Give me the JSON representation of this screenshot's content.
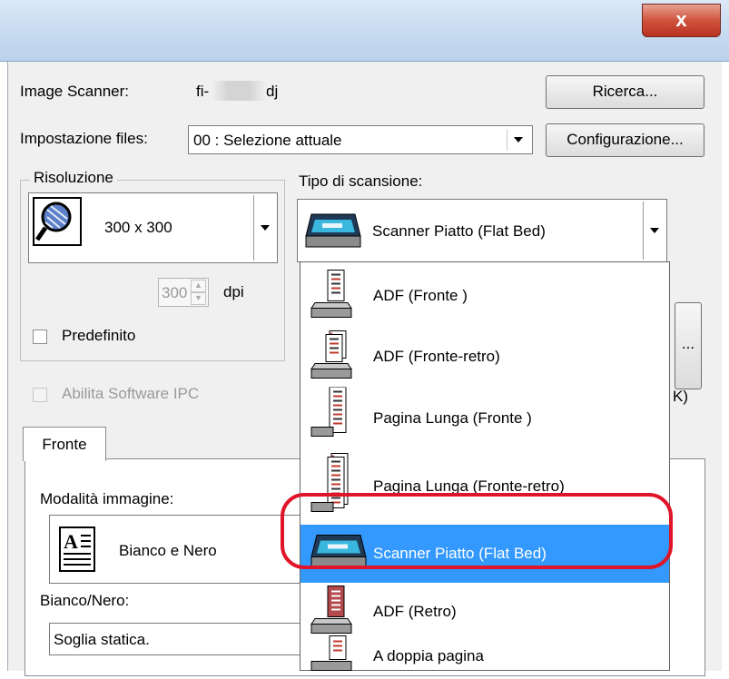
{
  "window": {
    "close_glyph": "x"
  },
  "scanner": {
    "label": "Image Scanner:",
    "model_prefix": "fi-",
    "model_suffix": "dj",
    "search_button": "Ricerca..."
  },
  "files": {
    "label": "Impostazione files:",
    "value": "00 : Selezione attuale",
    "config_button": "Configurazione..."
  },
  "resolution": {
    "group_label": "Risoluzione",
    "value": "300 x 300",
    "dpi_value": "300",
    "dpi_unit": "dpi",
    "default_label": "Predefinito"
  },
  "scan_type": {
    "label": "Tipo di scansione:",
    "value": "Scanner Piatto (Flat Bed)",
    "options": [
      {
        "label": "ADF (Fronte )",
        "icon": "adf-front-icon"
      },
      {
        "label": "ADF (Fronte-retro)",
        "icon": "adf-duplex-icon"
      },
      {
        "label": "Pagina Lunga (Fronte )",
        "icon": "long-page-front-icon"
      },
      {
        "label": "Pagina Lunga (Fronte-retro)",
        "icon": "long-page-duplex-icon"
      },
      {
        "label": "Scanner Piatto (Flat Bed)",
        "icon": "flatbed-scanner-icon",
        "selected": true
      },
      {
        "label": "ADF (Retro)",
        "icon": "adf-back-icon"
      },
      {
        "label": "A doppia pagina",
        "icon": "double-page-icon"
      }
    ]
  },
  "side_button": {
    "label": "..."
  },
  "partial_text": "K)",
  "ipc": {
    "label": "Abilita Software IPC"
  },
  "tabs": {
    "front": "Fronte"
  },
  "image_mode": {
    "label": "Modalità immagine:",
    "value": "Bianco e Nero"
  },
  "bw": {
    "label": "Bianco/Nero:",
    "value": "Soglia statica."
  },
  "colors": {
    "selection": "#3399ff",
    "highlight_ring": "#e01428",
    "close_button": "#c8432e"
  }
}
